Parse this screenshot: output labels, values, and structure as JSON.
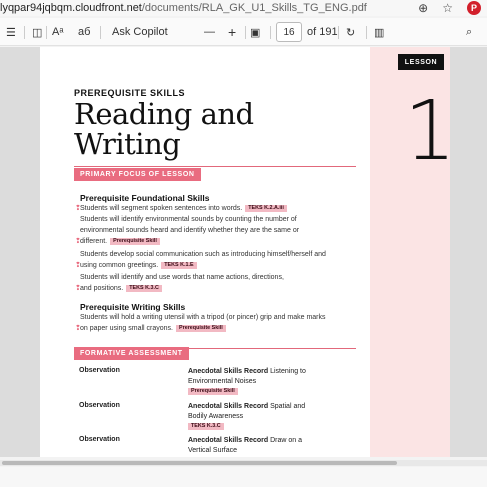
{
  "browser": {
    "url_prefix": "lyqpar94jqbqm.cloudfront.net",
    "url_path": "/documents/RLA_GK_U1_Skills_TG_ENG.pdf",
    "icons": [
      "zoom-icon",
      "star-icon",
      "pinterest-icon"
    ]
  },
  "toolbar": {
    "read_aloud": "Aᵃ",
    "translate": "aб",
    "ask_copilot": "Ask Copilot",
    "zoom_out": "—",
    "zoom_in": "+",
    "page_number": "16",
    "page_total": "of 191"
  },
  "document": {
    "lesson_label": "LESSON",
    "lesson_number": "1",
    "kicker": "PREREQUISITE SKILLS",
    "title_line1": "Reading and",
    "title_line2": "Writing",
    "primary_focus_banner": "PRIMARY FOCUS OF LESSON",
    "foundational_heading": "Prerequisite Foundational Skills",
    "foundational_lines": [
      {
        "text": "Students will segment spoken sentences into words.",
        "tag": "TEKS K.2.A.iii",
        "mark": true
      },
      {
        "text": "Students will identify environmental sounds by counting the number of",
        "tag": "",
        "mark": false
      },
      {
        "text": "environmental sounds heard and identify whether they are the same or",
        "tag": "",
        "mark": false
      },
      {
        "text": "different.",
        "tag": "Prerequisite Skill",
        "mark": true
      },
      {
        "text": "Students develop social communication such as introducing himself/herself and",
        "tag": "",
        "mark": false
      },
      {
        "text": "using common greetings.",
        "tag": "TEKS K.1.E",
        "mark": true
      },
      {
        "text": "Students will identify and use words that name actions, directions,",
        "tag": "",
        "mark": false
      },
      {
        "text": "and positions.",
        "tag": "TEKS K.3.C",
        "mark": true
      }
    ],
    "writing_heading": "Prerequisite Writing Skills",
    "writing_lines": [
      {
        "text": "Students will hold a writing utensil with a tripod (or pincer) grip and make marks",
        "tag": "",
        "mark": false
      },
      {
        "text": "on paper using small crayons.",
        "tag": "Prerequisite Skill",
        "mark": true
      }
    ],
    "formative_banner": "FORMATIVE ASSESSMENT",
    "assessments": [
      {
        "label": "Observation",
        "record": "Anecdotal Skills Record",
        "desc1": "Listening to",
        "desc2": "Environmental Noises",
        "tag": "Prerequisite Skill"
      },
      {
        "label": "Observation",
        "record": "Anecdotal Skills Record",
        "desc1": "Spatial and",
        "desc2": "Bodily Awareness",
        "tag": "TEKS K.3.C"
      },
      {
        "label": "Observation",
        "record": "Anecdotal Skills Record",
        "desc1": "Draw on a",
        "desc2": "Vertical Surface",
        "tag": ""
      }
    ]
  },
  "colors": {
    "accent_pink": "#e96c80",
    "tag_pink": "#f2b9c3",
    "side_panel": "#fbe4e4"
  }
}
